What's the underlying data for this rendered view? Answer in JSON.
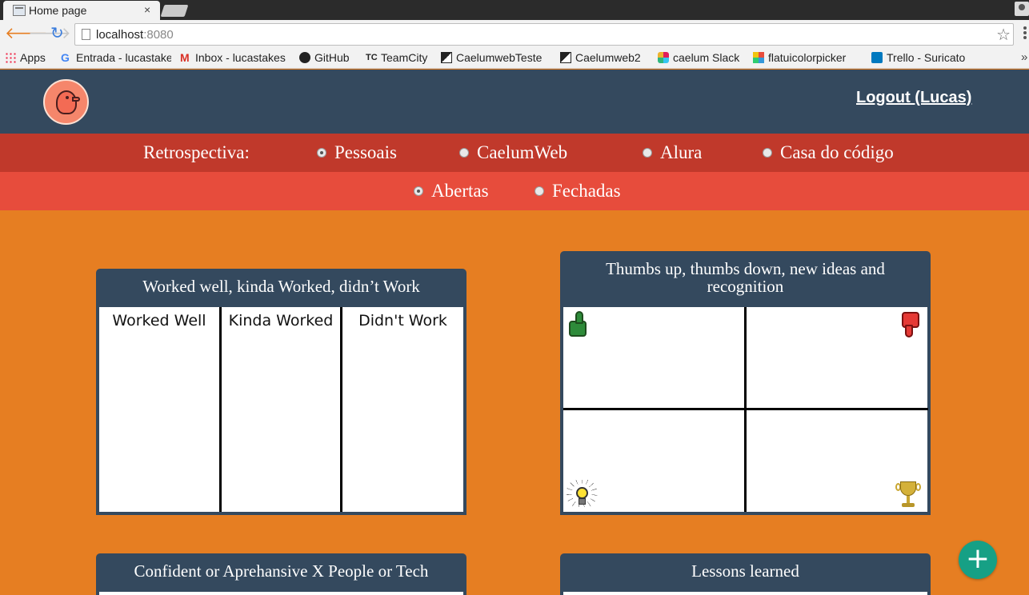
{
  "browser": {
    "tab_title": "Home page",
    "tab_close": "×",
    "url_host": "localhost",
    "url_port": ":8080",
    "bookmarks": [
      {
        "label": "Apps",
        "icon": "apps-grid-icon"
      },
      {
        "label": "Entrada - lucastakes",
        "icon": "google-icon"
      },
      {
        "label": "Inbox - lucastakes",
        "icon": "gmail-icon"
      },
      {
        "label": "GitHub",
        "icon": "github-icon"
      },
      {
        "label": "TeamCity",
        "icon": "teamcity-icon"
      },
      {
        "label": "CaelumwebTeste",
        "icon": "caelumweb-icon"
      },
      {
        "label": "Caelumweb2",
        "icon": "caelumweb-icon"
      },
      {
        "label": "caelum Slack",
        "icon": "slack-icon"
      },
      {
        "label": "flatuicolorpicker",
        "icon": "flatui-icon"
      },
      {
        "label": "Trello - Suricato",
        "icon": "trello-icon"
      }
    ],
    "more_bookmarks": "»"
  },
  "header": {
    "logout_label": "Logout (Lucas)"
  },
  "filters": {
    "project_label": "Retrospectiva:",
    "projects": [
      {
        "label": "Pessoais",
        "selected": true
      },
      {
        "label": "CaelumWeb",
        "selected": false
      },
      {
        "label": "Alura",
        "selected": false
      },
      {
        "label": "Casa do código",
        "selected": false
      }
    ],
    "statuses": [
      {
        "label": "Abertas",
        "selected": true
      },
      {
        "label": "Fechadas",
        "selected": false
      }
    ]
  },
  "cards": [
    {
      "title": "Worked well, kinda Worked, didn’t Work",
      "columns": [
        "Worked Well",
        "Kinda Worked",
        "Didn't Work"
      ]
    },
    {
      "title": "Thumbs up, thumbs down, new ideas and recognition",
      "quadrant_icons": [
        "thumbs-up-icon",
        "thumbs-down-icon",
        "lightbulb-icon",
        "trophy-icon"
      ]
    },
    {
      "title": "Confident or Aprehansive X People or Tech"
    },
    {
      "title": "Lessons learned"
    }
  ],
  "fab": {
    "label": "+"
  },
  "colors": {
    "page_bg": "#e67e22",
    "header_bg": "#34495e",
    "project_row_bg": "#c0392b",
    "status_row_bg": "#e74c3c",
    "fab_bg": "#16a085"
  }
}
